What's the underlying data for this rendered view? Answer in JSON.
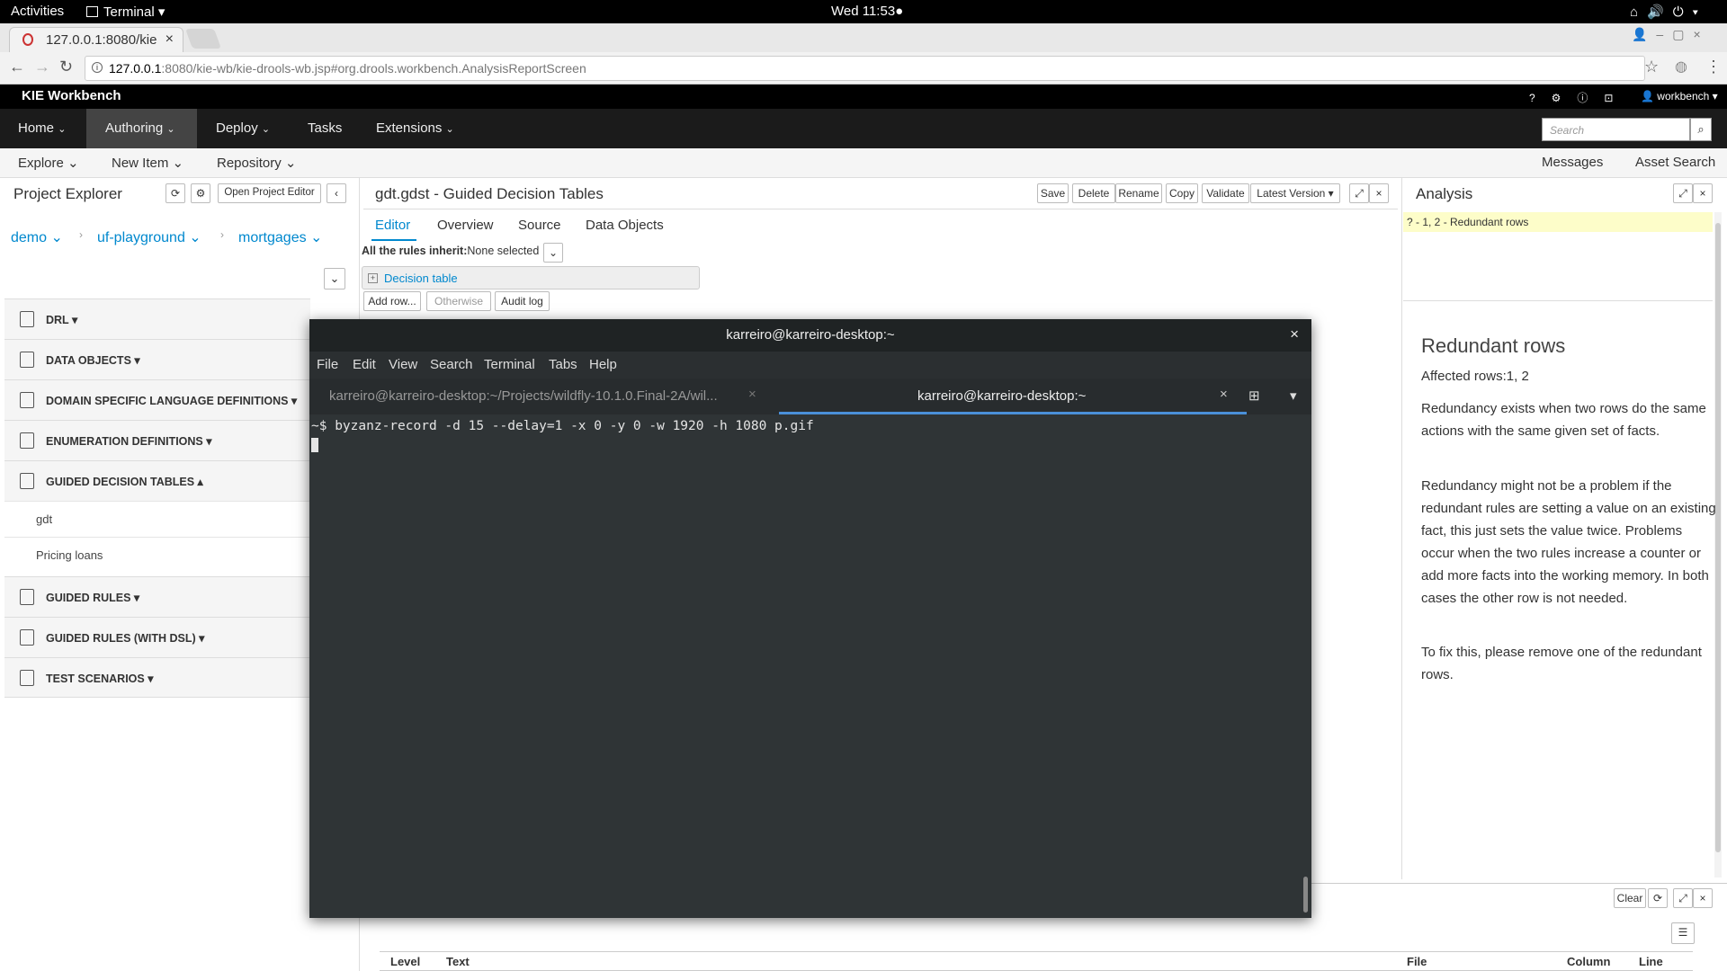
{
  "gnome": {
    "activities": "Activities",
    "app": "Terminal",
    "clock": "Wed 11:53●"
  },
  "browser": {
    "tab_title": "127.0.0.1:8080/kie",
    "url_host": "127.0.0.1",
    "url_rest": ":8080/kie-wb/kie-drools-wb.jsp#org.drools.workbench.AnalysisReportScreen"
  },
  "kie": {
    "brand": "KIE Workbench",
    "user": "workbench",
    "nav": [
      "Home",
      "Authoring",
      "Deploy",
      "Tasks",
      "Extensions"
    ],
    "search_placeholder": "Search",
    "subnav": {
      "explore": "Explore",
      "new_item": "New Item",
      "repository": "Repository",
      "messages": "Messages",
      "asset_search": "Asset Search"
    }
  },
  "explorer": {
    "title": "Project Explorer",
    "open_editor": "Open Project Editor",
    "crumbs": [
      "demo",
      "uf-playground",
      "mortgages"
    ],
    "categories": [
      "DRL",
      "DATA OBJECTS",
      "DOMAIN SPECIFIC LANGUAGE DEFINITIONS",
      "ENUMERATION DEFINITIONS",
      "GUIDED DECISION TABLES",
      "GUIDED RULES",
      "GUIDED RULES (WITH DSL)",
      "TEST SCENARIOS"
    ],
    "gdt_items": [
      "gdt",
      "Pricing loans"
    ]
  },
  "editor": {
    "title": "gdt.gdst - Guided Decision Tables",
    "actions": [
      "Save",
      "Delete",
      "Rename",
      "Copy",
      "Validate",
      "Latest Version"
    ],
    "tabs": [
      "Editor",
      "Overview",
      "Source",
      "Data Objects"
    ],
    "inherit_label": "All the rules inherit:",
    "inherit_value": "None selected",
    "decision_table": "Decision table",
    "buttons": [
      "Add row...",
      "Otherwise",
      "Audit log"
    ]
  },
  "analysis": {
    "title": "Analysis",
    "issue": "? - 1, 2 - Redundant rows",
    "heading": "Redundant rows",
    "affected": "Affected rows:1, 2",
    "p1": "Redundancy exists when two rows do the same actions with the same given set of facts.",
    "p2": "Redundancy might not be a problem if the redundant rules are setting a value on an existing fact, this just sets the value twice. Problems occur when the two rules increase a counter or add more facts into the working memory. In both cases the other row is not needed.",
    "p3": "To fix this, please remove one of the redundant rows."
  },
  "problems": {
    "clear": "Clear",
    "columns": [
      "Level",
      "Text",
      "File",
      "Column",
      "Line"
    ]
  },
  "terminal": {
    "title": "karreiro@karreiro-desktop:~",
    "menu": [
      "File",
      "Edit",
      "View",
      "Search",
      "Terminal",
      "Tabs",
      "Help"
    ],
    "tab1": "karreiro@karreiro-desktop:~/Projects/wildfly-10.1.0.Final-2A/wil...",
    "tab2": "karreiro@karreiro-desktop:~",
    "command": "~$ byzanz-record -d 15 --delay=1 -x 0 -y 0 -w 1920 -h 1080 p.gif"
  }
}
